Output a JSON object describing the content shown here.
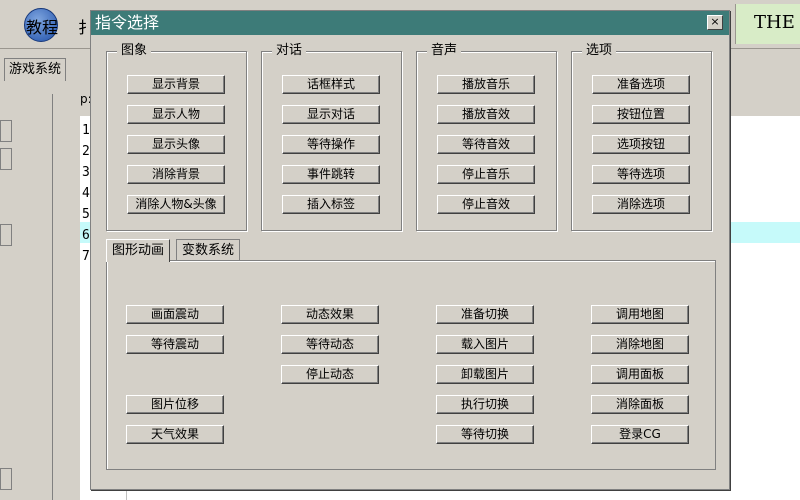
{
  "background": {
    "toolbar": {
      "tutorial_label": "教程",
      "second_label": "扌",
      "brand_text": "THE"
    },
    "tab_label": "游戏系统",
    "editor_label": "p:",
    "line_numbers": [
      "1",
      "2",
      "3",
      "4",
      "5",
      "6",
      "7"
    ]
  },
  "dialog": {
    "title": "指令选择",
    "close_glyph": "×",
    "groups": {
      "image": {
        "label": "图象",
        "buttons": [
          "显示背景",
          "显示人物",
          "显示头像",
          "消除背景",
          "消除人物&头像"
        ]
      },
      "dialogue": {
        "label": "对话",
        "buttons": [
          "话框样式",
          "显示对话",
          "等待操作",
          "事件跳转",
          "插入标签"
        ]
      },
      "sound": {
        "label": "音声",
        "buttons": [
          "播放音乐",
          "播放音效",
          "等待音效",
          "停止音乐",
          "停止音效"
        ]
      },
      "options": {
        "label": "选项",
        "buttons": [
          "准备选项",
          "按钮位置",
          "选项按钮",
          "等待选项",
          "消除选项"
        ]
      }
    },
    "tabs": [
      "图形动画",
      "变数系统"
    ],
    "anim": {
      "col1": [
        "画面震动",
        "等待震动",
        "图片位移",
        "天气效果"
      ],
      "col2": [
        "动态效果",
        "等待动态",
        "停止动态"
      ],
      "col3": [
        "准备切换",
        "载入图片",
        "卸载图片",
        "执行切换",
        "等待切换"
      ],
      "col4": [
        "调用地图",
        "消除地图",
        "调用面板",
        "消除面板",
        "登录CG"
      ]
    }
  }
}
